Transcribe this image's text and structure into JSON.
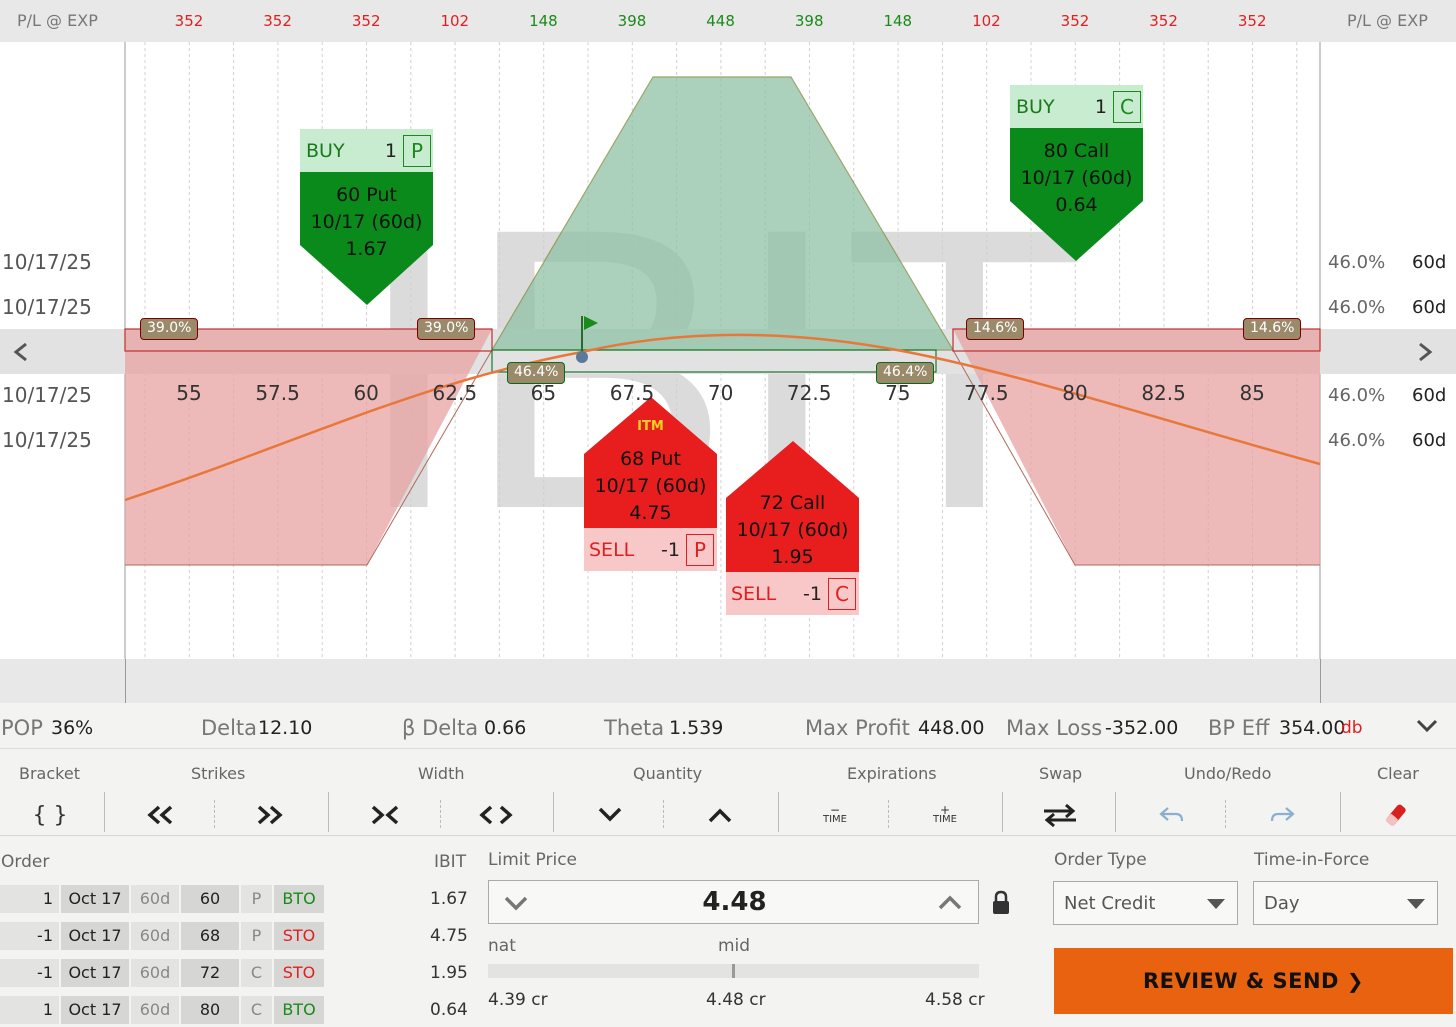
{
  "symbol_watermark": "IBIT",
  "pl_label": "P/L @ EXP",
  "pl_values": [
    {
      "v": "352",
      "c": "#e02020"
    },
    {
      "v": "352",
      "c": "#e02020"
    },
    {
      "v": "352",
      "c": "#e02020"
    },
    {
      "v": "102",
      "c": "#e02020"
    },
    {
      "v": "148",
      "c": "#1a8a1a"
    },
    {
      "v": "398",
      "c": "#1a8a1a"
    },
    {
      "v": "448",
      "c": "#1a8a1a"
    },
    {
      "v": "398",
      "c": "#1a8a1a"
    },
    {
      "v": "148",
      "c": "#1a8a1a"
    },
    {
      "v": "102",
      "c": "#e02020"
    },
    {
      "v": "352",
      "c": "#e02020"
    },
    {
      "v": "352",
      "c": "#e02020"
    },
    {
      "v": "352",
      "c": "#e02020"
    }
  ],
  "strikes": [
    "55",
    "57.5",
    "60",
    "62.5",
    "65",
    "67.5",
    "70",
    "72.5",
    "75",
    "77.5",
    "80",
    "82.5",
    "85"
  ],
  "expiry_rows": [
    {
      "date": "10/17/25",
      "iv": "46.0%",
      "dte": "60d"
    },
    {
      "date": "10/17/25",
      "iv": "46.0%",
      "dte": "60d"
    },
    {
      "date": "10/17/25",
      "iv": "46.0%",
      "dte": "60d"
    },
    {
      "date": "10/17/25",
      "iv": "46.0%",
      "dte": "60d"
    }
  ],
  "prob_tags": [
    "39.0%",
    "39.0%",
    "46.4%",
    "46.4%",
    "14.6%",
    "14.6%"
  ],
  "legs": [
    {
      "action": "BUY",
      "qty": "1",
      "type": "P",
      "desc": "60 Put",
      "exp": "10/17 (60d)",
      "price": "1.67"
    },
    {
      "action": "BUY",
      "qty": "1",
      "type": "C",
      "desc": "80 Call",
      "exp": "10/17 (60d)",
      "price": "0.64"
    },
    {
      "action": "SELL",
      "qty": "-1",
      "type": "P",
      "desc": "68 Put",
      "exp": "10/17 (60d)",
      "price": "4.75",
      "badge": "ITM"
    },
    {
      "action": "SELL",
      "qty": "-1",
      "type": "C",
      "desc": "72 Call",
      "exp": "10/17 (60d)",
      "price": "1.95"
    }
  ],
  "metrics": {
    "pop_label": "POP",
    "pop": "36%",
    "delta_label": "Delta",
    "delta": "12.10",
    "bdelta_label": "β Delta",
    "bdelta": "0.66",
    "theta_label": "Theta",
    "theta": "1.539",
    "maxp_label": "Max Profit",
    "maxp": "448.00",
    "maxl_label": "Max Loss",
    "maxl": "-352.00",
    "bp_label": "BP Eff",
    "bp": "354.00",
    "bp_unit": "db"
  },
  "toolbar": {
    "bracket": "Bracket",
    "strikes": "Strikes",
    "width": "Width",
    "quantity": "Quantity",
    "expirations": "Expirations",
    "swap": "Swap",
    "undo_redo": "Undo/Redo",
    "clear": "Clear",
    "bracket_icon": "{ }",
    "time": "TIME",
    "minus": "−",
    "plus": "+"
  },
  "order": {
    "label": "Order",
    "symbol": "IBIT",
    "rows": [
      {
        "qty": "1",
        "exp": "Oct 17",
        "dte": "60d",
        "strike": "60",
        "type": "P",
        "action": "BTO",
        "price": "1.67"
      },
      {
        "qty": "-1",
        "exp": "Oct 17",
        "dte": "60d",
        "strike": "68",
        "type": "P",
        "action": "STO",
        "price": "4.75"
      },
      {
        "qty": "-1",
        "exp": "Oct 17",
        "dte": "60d",
        "strike": "72",
        "type": "C",
        "action": "STO",
        "price": "1.95"
      },
      {
        "qty": "1",
        "exp": "Oct 17",
        "dte": "60d",
        "strike": "80",
        "type": "C",
        "action": "BTO",
        "price": "0.64"
      }
    ]
  },
  "limit": {
    "label": "Limit Price",
    "value": "4.48",
    "nat": "nat",
    "mid": "mid",
    "low": "4.39 cr",
    "midval": "4.48 cr",
    "high": "4.58 cr",
    "mid_fraction": 0.5
  },
  "order_type": {
    "label": "Order Type",
    "value": "Net Credit"
  },
  "tif": {
    "label": "Time-in-Force",
    "value": "Day"
  },
  "review_label": "REVIEW & SEND",
  "colors": {
    "accent": "#e8620f",
    "profit": "#1a8a1a",
    "loss": "#e02020"
  }
}
